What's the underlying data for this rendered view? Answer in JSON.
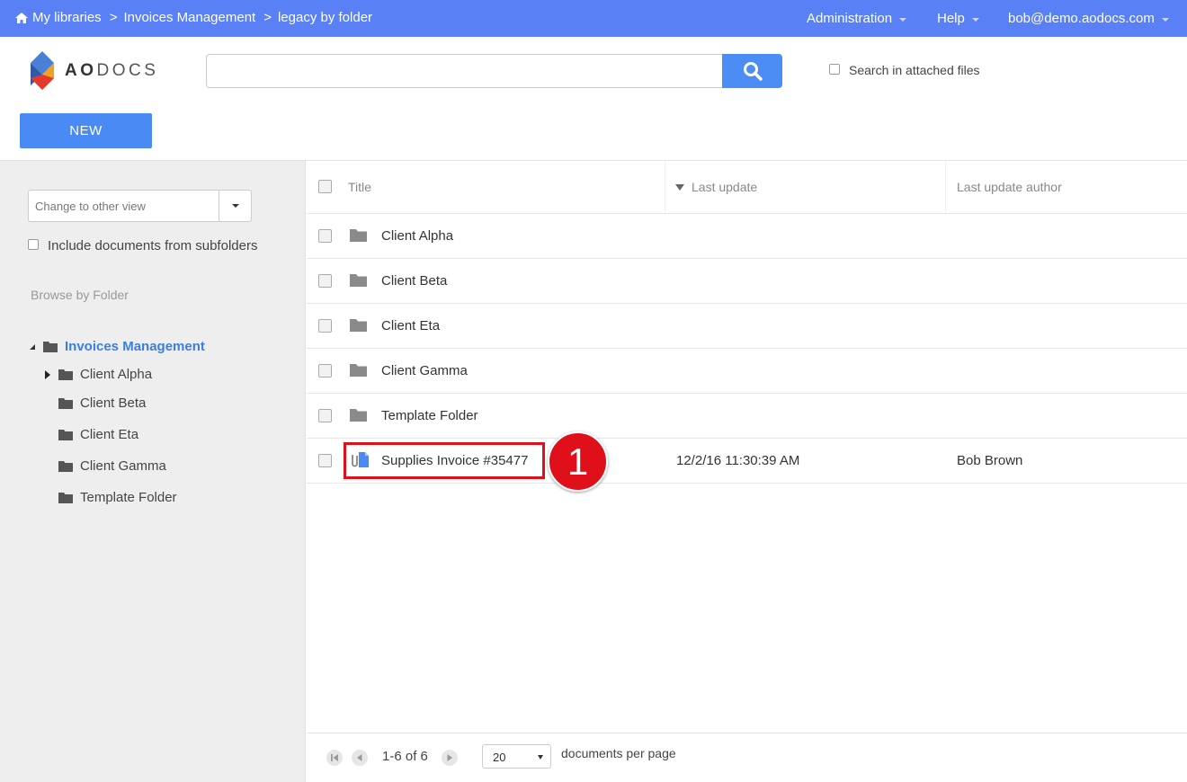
{
  "topbar": {
    "breadcrumbs": [
      "My libraries",
      "Invoices Management",
      "legacy by folder"
    ],
    "separator": ">",
    "menu": {
      "administration": "Administration",
      "help": "Help",
      "user": "bob@demo.aodocs.com"
    }
  },
  "header": {
    "logo_text_a": "AO",
    "logo_text_b": "DOCS",
    "search_value": "",
    "search_attached_label": "Search in attached files",
    "new_button": "NEW"
  },
  "sidebar": {
    "view_select": "Change to other view",
    "include_subfolders": "Include documents from subfolders",
    "browse_label": "Browse by Folder",
    "tree_root": "Invoices Management",
    "tree_items": [
      "Client Alpha",
      "Client Beta",
      "Client Eta",
      "Client Gamma",
      "Template Folder"
    ]
  },
  "list": {
    "columns": {
      "title": "Title",
      "last_update": "Last update",
      "author": "Last update author"
    },
    "rows": [
      {
        "type": "folder",
        "title": "Client Alpha",
        "last_update": "",
        "author": ""
      },
      {
        "type": "folder",
        "title": "Client Beta",
        "last_update": "",
        "author": ""
      },
      {
        "type": "folder",
        "title": "Client Eta",
        "last_update": "",
        "author": ""
      },
      {
        "type": "folder",
        "title": "Client Gamma",
        "last_update": "",
        "author": ""
      },
      {
        "type": "folder",
        "title": "Template Folder",
        "last_update": "",
        "author": ""
      },
      {
        "type": "document",
        "title": "Supplies Invoice #35477",
        "last_update": "12/2/16 11:30:39 AM",
        "author": "Bob Brown"
      }
    ],
    "callout_number": "1"
  },
  "footer": {
    "range": "1-6 of 6",
    "per_page_value": "20",
    "per_page_label": "documents per page"
  },
  "colors": {
    "topbar": "#5a80f5",
    "accent": "#4a8af4",
    "highlight": "#e0101a"
  }
}
